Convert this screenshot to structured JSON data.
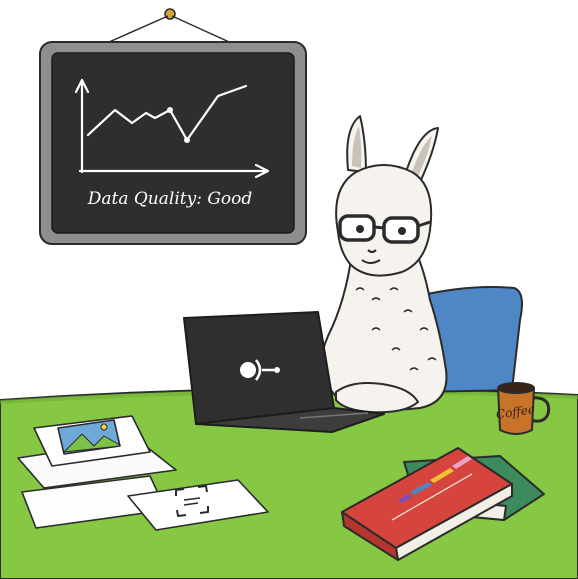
{
  "board": {
    "caption": "Data Quality: Good"
  },
  "mug": {
    "label": "Coffee"
  },
  "colors": {
    "desk": "#86c843",
    "desk_shadow": "#6fae35",
    "board_frame": "#8e8e8e",
    "board_surface": "#2e2e2e",
    "chair": "#4f86c6",
    "laptop": "#2f2f2f",
    "llama_fur": "#f6f3ee",
    "book_red": "#d6453d",
    "book_green": "#3d8a5c",
    "mug": "#c7742a"
  },
  "icons": [
    "laptop-logo-icon",
    "landscape-photo-icon",
    "scan-frame-icon",
    "bar-chart-icon",
    "line-chart-icon"
  ]
}
